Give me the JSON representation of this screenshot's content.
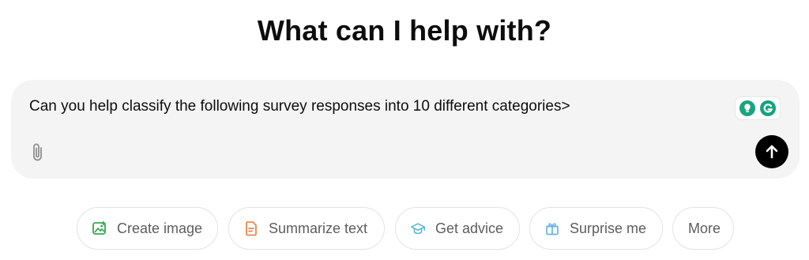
{
  "header": {
    "title": "What can I help with?"
  },
  "composer": {
    "text": "Can you help classify the following survey responses into 10 different categories>",
    "attach_icon": "paperclip-icon",
    "send_icon": "arrow-up-icon",
    "extension_icons": [
      "lightbulb-icon",
      "grammarly-icon"
    ]
  },
  "suggestions": [
    {
      "label": "Create image",
      "icon": "image-icon",
      "color": "#35a853"
    },
    {
      "label": "Summarize text",
      "icon": "document-icon",
      "color": "#e8874e"
    },
    {
      "label": "Get advice",
      "icon": "graduation-cap-icon",
      "color": "#55b8d8"
    },
    {
      "label": "Surprise me",
      "icon": "gift-icon",
      "color": "#67b3e0"
    },
    {
      "label": "More",
      "icon": "",
      "color": ""
    }
  ],
  "colors": {
    "composer_bg": "#f4f4f4",
    "send_button": "#000000",
    "grammarly_green": "#15a37f",
    "chip_text": "#5d5d5d"
  }
}
